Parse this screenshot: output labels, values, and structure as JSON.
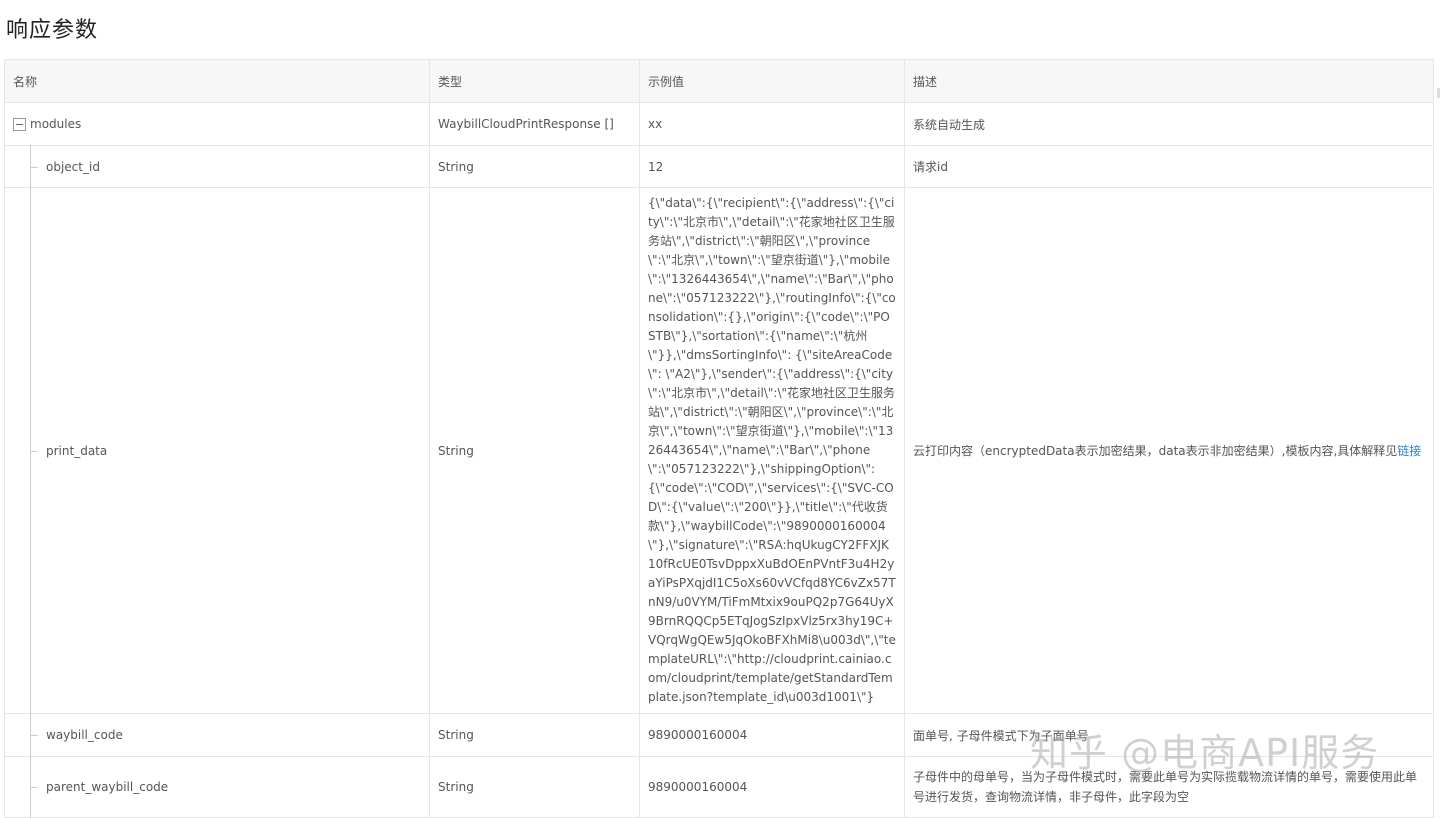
{
  "page": {
    "title": "响应参数"
  },
  "table": {
    "headers": {
      "name": "名称",
      "type": "类型",
      "example": "示例值",
      "desc": "描述"
    },
    "rows": [
      {
        "name": "modules",
        "type": "WaybillCloudPrintResponse []",
        "example": "xx",
        "desc": "系统自动生成"
      },
      {
        "name": "object_id",
        "type": "String",
        "example": "12",
        "desc": "请求id"
      },
      {
        "name": "print_data",
        "type": "String",
        "example": "{\\\"data\\\":{\\\"recipient\\\":{\\\"address\\\":{\\\"city\\\":\\\"北京市\\\",\\\"detail\\\":\\\"花家地社区卫生服务站\\\",\\\"district\\\":\\\"朝阳区\\\",\\\"province\\\":\\\"北京\\\",\\\"town\\\":\\\"望京街道\\\"},\\\"mobile\\\":\\\"1326443654\\\",\\\"name\\\":\\\"Bar\\\",\\\"phone\\\":\\\"057123222\\\"},\\\"routingInfo\\\":{\\\"consolidation\\\":{},\\\"origin\\\":{\\\"code\\\":\\\"POSTB\\\"},\\\"sortation\\\":{\\\"name\\\":\\\"杭州\\\"}},\\\"dmsSortingInfo\\\": {\\\"siteAreaCode\\\": \\\"A2\\\"},\\\"sender\\\":{\\\"address\\\":{\\\"city\\\":\\\"北京市\\\",\\\"detail\\\":\\\"花家地社区卫生服务站\\\",\\\"district\\\":\\\"朝阳区\\\",\\\"province\\\":\\\"北京\\\",\\\"town\\\":\\\"望京街道\\\"},\\\"mobile\\\":\\\"1326443654\\\",\\\"name\\\":\\\"Bar\\\",\\\"phone\\\":\\\"057123222\\\"},\\\"shippingOption\\\":{\\\"code\\\":\\\"COD\\\",\\\"services\\\":{\\\"SVC-COD\\\":{\\\"value\\\":\\\"200\\\"}},\\\"title\\\":\\\"代收货款\\\"},\\\"waybillCode\\\":\\\"9890000160004\\\"},\\\"signature\\\":\\\"RSA:hqUkugCY2FFXJK10fRcUE0TsvDppxXuBdOEnPVntF3u4H2yaYiPsPXqjdI1C5oXs60vVCfqd8YC6vZx57TnN9/u0VYM/TiFmMtxix9ouPQ2p7G64UyX9BrnRQQCp5ETqJogSzIpxVlz5rx3hy19C+VQrqWgQEw5JqOkoBFXhMi8\\u003d\\\",\\\"templateURL\\\":\\\"http://cloudprint.cainiao.com/cloudprint/template/getStandardTemplate.json?template_id\\u003d1001\\\"}",
        "desc": "云打印内容（encryptedData表示加密结果，data表示非加密结果）,模板内容,具体解释见",
        "desc_link": "链接"
      },
      {
        "name": "waybill_code",
        "type": "String",
        "example": "9890000160004",
        "desc": "面单号, 子母件模式下为子面单号"
      },
      {
        "name": "parent_waybill_code",
        "type": "String",
        "example": "9890000160004",
        "desc": "子母件中的母单号，当为子母件模式时，需要此单号为实际揽载物流详情的单号，需要使用此单号进行发货，查询物流详情，非子母件，此字段为空"
      }
    ]
  },
  "watermark": {
    "text": "知乎 @电商API服务"
  }
}
